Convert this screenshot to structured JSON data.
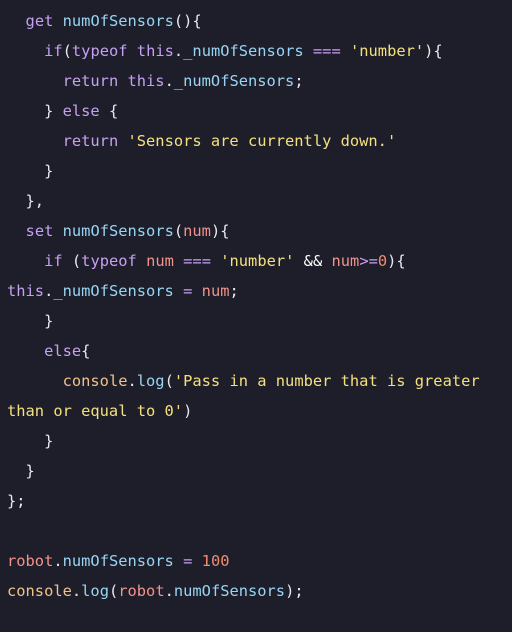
{
  "theme": {
    "background": "#1e1e2a",
    "plain": "#e8e8ee",
    "keyword": "#c7a0f2",
    "function": "#98d5f4",
    "string": "#f4e07e",
    "number": "#ef8c74",
    "parameter": "#f2938b",
    "object": "#f1c389",
    "property": "#ffffff"
  },
  "lines": [
    [
      {
        "t": "  ",
        "c": "plain"
      },
      {
        "t": "get",
        "c": "kw"
      },
      {
        "t": " ",
        "c": "plain"
      },
      {
        "t": "numOfSensors",
        "c": "fn"
      },
      {
        "t": "(){",
        "c": "plain"
      }
    ],
    [
      {
        "t": "    ",
        "c": "plain"
      },
      {
        "t": "if",
        "c": "kw"
      },
      {
        "t": "(",
        "c": "plain"
      },
      {
        "t": "typeof",
        "c": "kw"
      },
      {
        "t": " ",
        "c": "plain"
      },
      {
        "t": "this",
        "c": "kw"
      },
      {
        "t": ".",
        "c": "plain"
      },
      {
        "t": "_numOfSensors",
        "c": "fn"
      },
      {
        "t": " ",
        "c": "plain"
      },
      {
        "t": "===",
        "c": "kw"
      },
      {
        "t": " ",
        "c": "plain"
      },
      {
        "t": "'number'",
        "c": "str"
      },
      {
        "t": "){",
        "c": "plain"
      }
    ],
    [
      {
        "t": "      ",
        "c": "plain"
      },
      {
        "t": "return",
        "c": "kw"
      },
      {
        "t": " ",
        "c": "plain"
      },
      {
        "t": "this",
        "c": "kw"
      },
      {
        "t": ".",
        "c": "plain"
      },
      {
        "t": "_numOfSensors",
        "c": "fn"
      },
      {
        "t": ";",
        "c": "plain"
      }
    ],
    [
      {
        "t": "    } ",
        "c": "plain"
      },
      {
        "t": "else",
        "c": "kw"
      },
      {
        "t": " {",
        "c": "plain"
      }
    ],
    [
      {
        "t": "      ",
        "c": "plain"
      },
      {
        "t": "return",
        "c": "kw"
      },
      {
        "t": " ",
        "c": "plain"
      },
      {
        "t": "'Sensors are currently down.'",
        "c": "str"
      }
    ],
    [
      {
        "t": "    }",
        "c": "plain"
      }
    ],
    [
      {
        "t": "  },",
        "c": "plain"
      }
    ],
    [
      {
        "t": "  ",
        "c": "plain"
      },
      {
        "t": "set",
        "c": "kw"
      },
      {
        "t": " ",
        "c": "plain"
      },
      {
        "t": "numOfSensors",
        "c": "fn"
      },
      {
        "t": "(",
        "c": "plain"
      },
      {
        "t": "num",
        "c": "param"
      },
      {
        "t": "){",
        "c": "plain"
      }
    ],
    [
      {
        "t": "    ",
        "c": "plain"
      },
      {
        "t": "if",
        "c": "kw"
      },
      {
        "t": " (",
        "c": "plain"
      },
      {
        "t": "typeof",
        "c": "kw"
      },
      {
        "t": " ",
        "c": "plain"
      },
      {
        "t": "num",
        "c": "param"
      },
      {
        "t": " ",
        "c": "plain"
      },
      {
        "t": "===",
        "c": "kw"
      },
      {
        "t": " ",
        "c": "plain"
      },
      {
        "t": "'number'",
        "c": "str"
      },
      {
        "t": " ",
        "c": "plain"
      },
      {
        "t": "&&",
        "c": "prop"
      },
      {
        "t": " ",
        "c": "plain"
      },
      {
        "t": "num",
        "c": "param"
      },
      {
        "t": ">=",
        "c": "kw"
      },
      {
        "t": "0",
        "c": "num"
      },
      {
        "t": "){",
        "c": "plain"
      }
    ],
    [
      {
        "t": "this",
        "c": "kw"
      },
      {
        "t": ".",
        "c": "plain"
      },
      {
        "t": "_numOfSensors",
        "c": "fn"
      },
      {
        "t": " ",
        "c": "plain"
      },
      {
        "t": "=",
        "c": "kw"
      },
      {
        "t": " ",
        "c": "plain"
      },
      {
        "t": "num",
        "c": "param"
      },
      {
        "t": ";",
        "c": "plain"
      }
    ],
    [
      {
        "t": "    }",
        "c": "plain"
      }
    ],
    [
      {
        "t": "    ",
        "c": "plain"
      },
      {
        "t": "else",
        "c": "kw"
      },
      {
        "t": "{",
        "c": "plain"
      }
    ],
    [
      {
        "t": "      ",
        "c": "plain"
      },
      {
        "t": "console",
        "c": "obj"
      },
      {
        "t": ".",
        "c": "plain"
      },
      {
        "t": "log",
        "c": "fn"
      },
      {
        "t": "(",
        "c": "plain"
      },
      {
        "t": "'Pass in a number that is greater",
        "c": "str"
      }
    ],
    [
      {
        "t": "than or equal to 0'",
        "c": "str"
      },
      {
        "t": ")",
        "c": "plain"
      }
    ],
    [
      {
        "t": "    }",
        "c": "plain"
      }
    ],
    [
      {
        "t": "  }",
        "c": "plain"
      }
    ],
    [
      {
        "t": "};",
        "c": "plain"
      }
    ],
    [],
    [
      {
        "t": "robot",
        "c": "param"
      },
      {
        "t": ".",
        "c": "plain"
      },
      {
        "t": "numOfSensors",
        "c": "fn"
      },
      {
        "t": " ",
        "c": "plain"
      },
      {
        "t": "=",
        "c": "kw"
      },
      {
        "t": " ",
        "c": "plain"
      },
      {
        "t": "100",
        "c": "num"
      }
    ],
    [
      {
        "t": "console",
        "c": "obj"
      },
      {
        "t": ".",
        "c": "plain"
      },
      {
        "t": "log",
        "c": "fn"
      },
      {
        "t": "(",
        "c": "plain"
      },
      {
        "t": "robot",
        "c": "param"
      },
      {
        "t": ".",
        "c": "plain"
      },
      {
        "t": "numOfSensors",
        "c": "fn"
      },
      {
        "t": ");",
        "c": "plain"
      }
    ]
  ]
}
